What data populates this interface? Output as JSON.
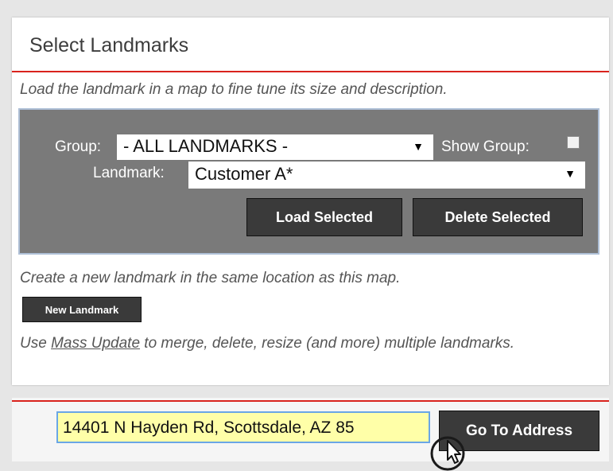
{
  "panel": {
    "title": "Select Landmarks",
    "load_hint": "Load the landmark in a map to fine tune its size and description.",
    "controls": {
      "group_label": "Group:",
      "group_value": "- ALL LANDMARKS -",
      "show_group_label": "Show Group:",
      "show_group_checked": false,
      "landmark_label": "Landmark:",
      "landmark_value": "Customer A*",
      "load_button": "Load Selected",
      "delete_button": "Delete Selected"
    },
    "create_hint": "Create a new landmark in the same location as this map.",
    "new_button": "New Landmark",
    "mass_hint": {
      "prefix": "Use ",
      "link": "Mass Update",
      "suffix": " to merge, delete, resize (and more) multiple landmarks."
    }
  },
  "address_bar": {
    "address_value": "14401 N Hayden Rd, Scottsdale, AZ 85",
    "go_button": "Go To Address"
  },
  "colors": {
    "accent_red": "#d9231d",
    "controls_bg": "#7a7a7a",
    "button_bg": "#3a3a3a",
    "input_highlight": "#ffffa8"
  },
  "icons": {
    "dropdown": "caret-down-icon",
    "cursor": "hand-pointer-cursor-icon"
  }
}
